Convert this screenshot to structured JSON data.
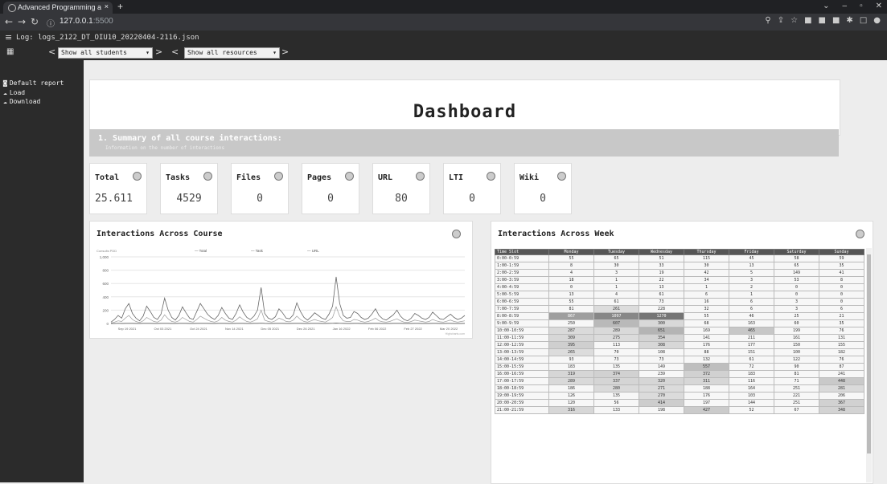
{
  "browser": {
    "tab_title": "Advanced Programming and dat",
    "tab_close": "×",
    "new_tab": "+",
    "url_host": "127.0.0.1",
    "url_port": ":5500"
  },
  "app": {
    "menu_icon": "≡",
    "log_label": "Log: logs_2122_DT_OIU10_20220404-2116.json",
    "students_select": "Show all students",
    "resources_select": "Show all resources",
    "prev": "<",
    "next": ">"
  },
  "sidebar": {
    "items": [
      {
        "icon": "report-icon",
        "label": "Default report"
      },
      {
        "icon": "cloud-upload-icon",
        "label": "Load"
      },
      {
        "icon": "cloud-download-icon",
        "label": "Download"
      }
    ]
  },
  "dashboard": {
    "title": "Dashboard",
    "summary_title": "1. Summary of all course interactions:",
    "summary_subtitle": "Information on the number of interactions"
  },
  "kpis": [
    {
      "label": "Total",
      "value": "25.611"
    },
    {
      "label": "Tasks",
      "value": "4529"
    },
    {
      "label": "Files",
      "value": "0"
    },
    {
      "label": "Pages",
      "value": "0"
    },
    {
      "label": "URL",
      "value": "80"
    },
    {
      "label": "LTI",
      "value": "0"
    },
    {
      "label": "Wiki",
      "value": "0"
    }
  ],
  "course_chart": {
    "title": "Interactions Across Course"
  },
  "chart_data": {
    "type": "line",
    "title": "Interactions Across Course",
    "ylabel_small": "Consults PDD",
    "ylim": [
      0,
      1000
    ],
    "yticks": [
      "1,000",
      "800",
      "600",
      "400",
      "200",
      "0"
    ],
    "xticks": [
      "Sep 19 2021",
      "Oct 03 2021",
      "Oct 24 2021",
      "Nov 14 2021",
      "Dec 05 2021",
      "Dec 26 2021",
      "Jan 16 2022",
      "Feb 06 2022",
      "Feb 27 2022",
      "Mar 20 2022"
    ],
    "legend": [
      "— Total",
      "— Task",
      "— URL"
    ],
    "series": [
      {
        "name": "Total",
        "values": [
          20,
          60,
          120,
          80,
          220,
          300,
          150,
          80,
          40,
          110,
          260,
          180,
          90,
          60,
          140,
          380,
          200,
          90,
          50,
          120,
          250,
          160,
          80,
          60,
          180,
          300,
          220,
          140,
          90,
          60,
          120,
          240,
          150,
          80,
          60,
          150,
          280,
          170,
          90,
          60,
          110,
          200,
          540,
          150,
          80,
          60,
          100,
          220,
          160,
          80,
          70,
          130,
          310,
          180,
          90,
          50,
          100,
          160,
          120,
          80,
          60,
          140,
          260,
          700,
          300,
          120,
          80,
          90,
          180,
          150,
          90,
          60,
          80,
          140,
          220,
          120,
          70,
          50,
          90,
          130,
          200,
          110,
          60,
          40,
          80,
          150,
          120,
          80,
          60,
          90,
          170,
          120,
          70,
          60,
          100,
          140,
          90,
          60,
          80,
          120
        ]
      },
      {
        "name": "Task",
        "values": [
          5,
          20,
          40,
          30,
          80,
          120,
          60,
          30,
          15,
          40,
          90,
          60,
          30,
          20,
          50,
          130,
          70,
          30,
          20,
          40,
          90,
          60,
          30,
          20,
          60,
          110,
          80,
          50,
          30,
          20,
          40,
          90,
          50,
          30,
          20,
          50,
          100,
          60,
          30,
          20,
          40,
          70,
          200,
          50,
          30,
          20,
          40,
          80,
          60,
          30,
          25,
          50,
          110,
          60,
          30,
          20,
          40,
          60,
          40,
          30,
          20,
          50,
          90,
          250,
          110,
          40,
          30,
          30,
          60,
          50,
          30,
          20,
          30,
          50,
          80,
          40,
          25,
          20,
          30,
          50,
          70,
          40,
          20,
          15,
          30,
          50,
          40,
          30,
          20,
          30,
          60,
          40,
          25,
          20,
          35,
          50,
          30,
          20,
          30,
          40
        ]
      },
      {
        "name": "URL",
        "values": [
          0,
          0,
          2,
          0,
          1,
          3,
          1,
          0,
          0,
          1,
          2,
          1,
          0,
          0,
          1,
          3,
          1,
          0,
          0,
          1,
          2,
          1,
          0,
          0,
          1,
          2,
          1,
          1,
          0,
          0,
          1,
          2,
          1,
          0,
          0,
          1,
          2,
          1,
          0,
          0,
          1,
          1,
          4,
          1,
          0,
          0,
          1,
          2,
          1,
          0,
          0,
          1,
          2,
          1,
          0,
          0,
          1,
          1,
          1,
          0,
          0,
          1,
          2,
          5,
          2,
          1,
          0,
          0,
          1,
          1,
          0,
          0,
          0,
          1,
          2,
          1,
          0,
          0,
          0,
          1,
          1,
          1,
          0,
          0,
          0,
          1,
          1,
          0,
          0,
          0,
          1,
          1,
          0,
          0,
          1,
          1,
          0,
          0,
          0,
          1
        ]
      }
    ],
    "footer_note": "Highcharts.com"
  },
  "week": {
    "title": "Interactions Across Week",
    "headers": [
      "Time Slot",
      "Monday",
      "Tuesday",
      "Wednesday",
      "Thursday",
      "Friday",
      "Saturday",
      "Sunday"
    ],
    "rows": [
      [
        "0:00-0:59",
        "55",
        "65",
        "51",
        "115",
        "45",
        "58",
        "59"
      ],
      [
        "1:00-1:59",
        "8",
        "30",
        "33",
        "30",
        "13",
        "65",
        "35"
      ],
      [
        "2:00-2:59",
        "4",
        "3",
        "19",
        "42",
        "5",
        "149",
        "41"
      ],
      [
        "3:00-3:59",
        "18",
        "1",
        "22",
        "34",
        "3",
        "53",
        "8"
      ],
      [
        "4:00-4:59",
        "0",
        "1",
        "13",
        "1",
        "2",
        "0",
        "0"
      ],
      [
        "5:00-5:59",
        "13",
        "4",
        "61",
        "6",
        "1",
        "0",
        "0"
      ],
      [
        "6:00-6:59",
        "55",
        "61",
        "73",
        "16",
        "6",
        "3",
        "0"
      ],
      [
        "7:00-7:59",
        "81",
        "261",
        "228",
        "32",
        "6",
        "3",
        "6"
      ],
      [
        "8:00-8:59",
        "867",
        "1097",
        "1270",
        "55",
        "46",
        "25",
        "21"
      ],
      [
        "9:00-9:59",
        "250",
        "607",
        "300",
        "68",
        "163",
        "60",
        "35"
      ],
      [
        "10:00-10:59",
        "287",
        "289",
        "651",
        "169",
        "465",
        "199",
        "76"
      ],
      [
        "11:00-11:59",
        "309",
        "275",
        "354",
        "141",
        "211",
        "161",
        "131"
      ],
      [
        "12:00-12:59",
        "395",
        "113",
        "308",
        "176",
        "177",
        "150",
        "155"
      ],
      [
        "13:00-13:59",
        "265",
        "70",
        "108",
        "88",
        "151",
        "100",
        "182"
      ],
      [
        "14:00-14:59",
        "93",
        "73",
        "73",
        "132",
        "61",
        "122",
        "76"
      ],
      [
        "15:00-15:59",
        "183",
        "135",
        "149",
        "557",
        "72",
        "90",
        "87"
      ],
      [
        "16:00-16:59",
        "319",
        "374",
        "239",
        "372",
        "183",
        "81",
        "241"
      ],
      [
        "17:00-17:59",
        "289",
        "337",
        "320",
        "311",
        "116",
        "71",
        "448"
      ],
      [
        "18:00-18:59",
        "186",
        "280",
        "271",
        "188",
        "164",
        "251",
        "281"
      ],
      [
        "19:00-19:59",
        "126",
        "135",
        "270",
        "176",
        "103",
        "221",
        "206"
      ],
      [
        "20:00-20:59",
        "120",
        "56",
        "414",
        "197",
        "144",
        "251",
        "367"
      ],
      [
        "21:00-21:59",
        "316",
        "133",
        "198",
        "427",
        "52",
        "67",
        "348"
      ]
    ]
  },
  "colors": {
    "chrome_dark": "#202124",
    "sidebar": "#2b2b2b",
    "header_gray": "#c8c8c8",
    "table_header": "#555555",
    "line": "#555555"
  }
}
